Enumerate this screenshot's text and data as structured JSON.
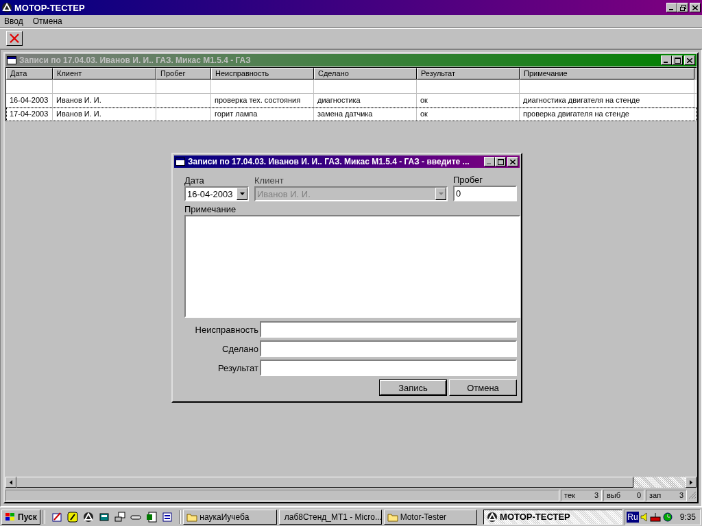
{
  "window": {
    "title": "МОТОР-ТЕСТЕР"
  },
  "menu": [
    "Ввод",
    "Отмена"
  ],
  "records_window": {
    "title": "Записи по 17.04.03. Иванов И. И.. ГАЗ. Микас М1.5.4 - ГАЗ",
    "columns": [
      "Дата",
      "Клиент",
      "Пробег",
      "Неисправность",
      "Сделано",
      "Результат",
      "Примечание"
    ],
    "rows": [
      {
        "selected": false,
        "cells": [
          "16-04-2003",
          "Иванов И. И.",
          "",
          "проверка тех. состояния",
          "диагностика",
          "ок",
          "диагностика  двигателя на стенде"
        ]
      },
      {
        "selected": true,
        "cells": [
          "17-04-2003",
          "Иванов И. И.",
          "",
          "горит лампа",
          "замена датчика",
          "ок",
          "проверка двигателя на стенде"
        ]
      }
    ],
    "status_bar": [
      {
        "label": "тек",
        "value": "3"
      },
      {
        "label": "выб",
        "value": "0"
      },
      {
        "label": "зап",
        "value": "3"
      }
    ]
  },
  "dialog": {
    "title": "Записи по 17.04.03. Иванов И. И.. ГАЗ. Микас М1.5.4 - ГАЗ - введите ...",
    "date": {
      "label": "Дата",
      "value": "16-04-2003"
    },
    "client": {
      "label": "Клиент",
      "value": "Иванов И. И.",
      "disabled": true
    },
    "mileage": {
      "label": "Пробег",
      "value": "0"
    },
    "note": {
      "label": "Примечание"
    },
    "fields": [
      {
        "label": "Неисправность"
      },
      {
        "label": "Сделано"
      },
      {
        "label": "Результат"
      }
    ],
    "buttons": [
      {
        "label": "Запись",
        "default": true
      },
      {
        "label": "Отмена",
        "default": false
      }
    ]
  },
  "taskbar": {
    "start": "Пуск",
    "tasks": [
      {
        "kind": "folder",
        "label": "наукаИучеба",
        "selected": false
      },
      {
        "kind": "document",
        "label": "лаб8Стенд_МТ1 - Micro...",
        "selected": false
      },
      {
        "kind": "folder",
        "label": "Motor-Tester",
        "selected": false
      },
      {
        "kind": "app",
        "label": "МОТОР-ТЕСТЕР",
        "selected": true
      }
    ],
    "language": "Ru",
    "time": "9:35"
  }
}
